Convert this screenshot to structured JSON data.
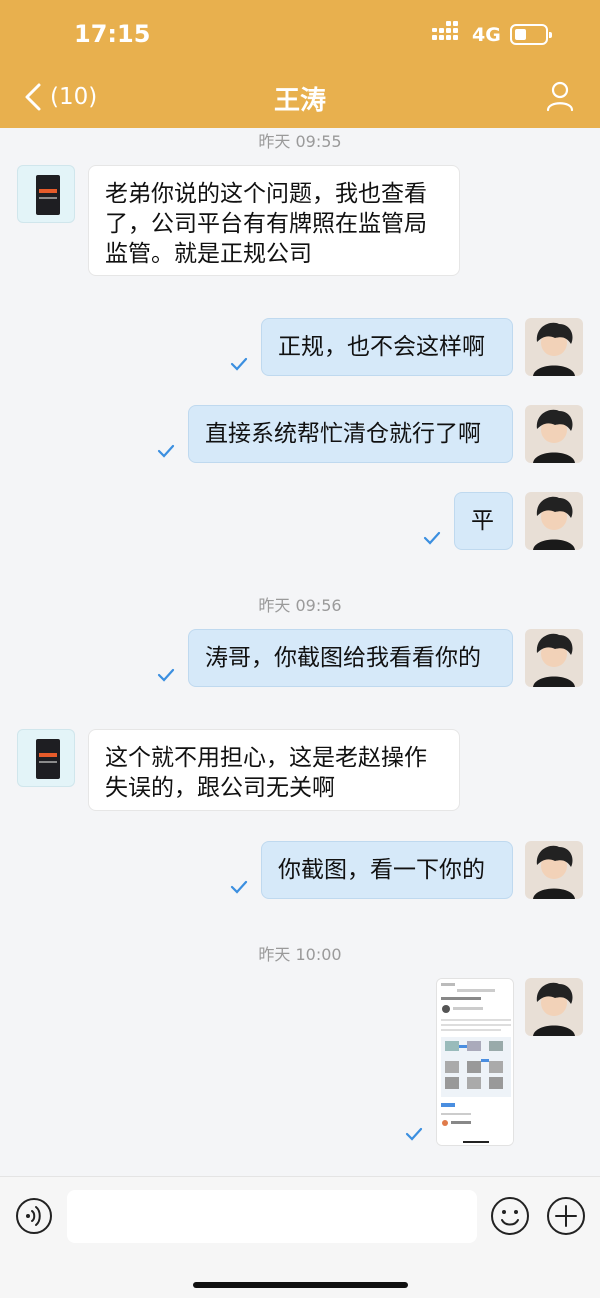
{
  "status": {
    "time": "17:15",
    "network": "4G"
  },
  "header": {
    "back_count": "(10)",
    "title": "王涛"
  },
  "timestamps": [
    "昨天 09:55",
    "昨天 09:56",
    "昨天 10:00"
  ],
  "messages": [
    {
      "side": "left",
      "lines": [
        "老弟你说的这个问题，我也查看",
        "了，公司平台有有牌照在监管局",
        "监管。就是正规公司"
      ]
    },
    {
      "side": "right",
      "text": "正规，也不会这样啊"
    },
    {
      "side": "right",
      "text": "直接系统帮忙清仓就行了啊"
    },
    {
      "side": "right",
      "text": "平"
    },
    {
      "side": "right",
      "text": "涛哥，你截图给我看看你的"
    },
    {
      "side": "left",
      "lines": [
        "这个就不用担心，这是老赵操作",
        "失误的，跟公司无关啊"
      ]
    },
    {
      "side": "right",
      "text": "你截图，看一下你的"
    },
    {
      "side": "right",
      "type": "image",
      "icon": "screenshot-thumbnail"
    }
  ],
  "input": {
    "placeholder": ""
  },
  "colors": {
    "header": "#e8b04e",
    "bubble_right": "#d6e9f9",
    "check": "#3b8fe0"
  },
  "icons": [
    "chevron-left-icon",
    "profile-icon",
    "voice-icon",
    "emoji-icon",
    "plus-icon",
    "check-icon"
  ]
}
